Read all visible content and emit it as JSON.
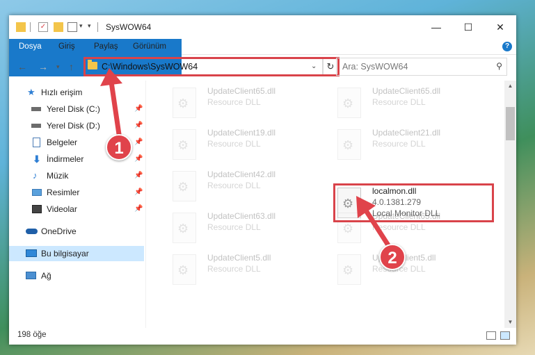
{
  "window": {
    "title": "SysWOW64",
    "controls": {
      "minimize": "—",
      "maximize": "☐",
      "close": "✕"
    }
  },
  "ribbon": {
    "tabs": [
      "Dosya",
      "Giriş",
      "Paylaş",
      "Görünüm"
    ],
    "help": "?"
  },
  "address": {
    "path": "C:\\Windows\\SysWOW64",
    "search_placeholder": "Ara: SysWOW64"
  },
  "nav": {
    "items": [
      {
        "label": "Hızlı erişim",
        "icon": "star-icon",
        "pinned": false
      },
      {
        "label": "Yerel Disk (C:)",
        "icon": "drive-icon",
        "pinned": true
      },
      {
        "label": "Yerel Disk (D:)",
        "icon": "drive-icon",
        "pinned": true
      },
      {
        "label": "Belgeler",
        "icon": "documents-icon",
        "pinned": true
      },
      {
        "label": "İndirmeler",
        "icon": "download-icon",
        "pinned": true
      },
      {
        "label": "Müzik",
        "icon": "music-icon",
        "pinned": true
      },
      {
        "label": "Resimler",
        "icon": "pictures-icon",
        "pinned": true
      },
      {
        "label": "Videolar",
        "icon": "videos-icon",
        "pinned": true
      },
      {
        "label": "OneDrive",
        "icon": "cloud-icon",
        "pinned": false
      },
      {
        "label": "Bu bilgisayar",
        "icon": "computer-icon",
        "pinned": false,
        "selected": true
      },
      {
        "label": "Ağ",
        "icon": "network-icon",
        "pinned": false
      }
    ]
  },
  "files": [
    {
      "name": "UpdateClient65.dll",
      "desc": "Resource DLL"
    },
    {
      "name": "UpdateClient65.dll",
      "desc": "Resource DLL"
    },
    {
      "name": "UpdateClient19.dll",
      "desc": "Resource DLL"
    },
    {
      "name": "UpdateClient21.dll",
      "desc": "Resource DLL"
    },
    {
      "name": "UpdateClient42.dll",
      "desc": "Resource DLL"
    },
    {
      "name": "localmon.dll",
      "desc": "4.0.1381.279",
      "desc2": "Local Monitor DLL"
    },
    {
      "name": "UpdateClient63.dll",
      "desc": "Resource DLL"
    },
    {
      "name": "UpdateClient65.dll",
      "desc": "Resource DLL"
    },
    {
      "name": "UpdateClient5.dll",
      "desc": "Resource DLL"
    },
    {
      "name": "UpdateClient5.dll",
      "desc": "Resource DLL"
    }
  ],
  "status": {
    "count": "198 öğe"
  },
  "annotations": {
    "step1": "1",
    "step2": "2",
    "color": "#e0434b"
  }
}
